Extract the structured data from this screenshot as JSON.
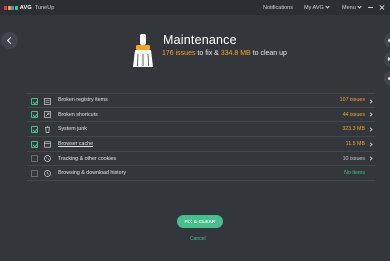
{
  "app": {
    "brand": "AVG",
    "product": "TuneUp"
  },
  "nav": {
    "notifications": "Notifications",
    "my_avg": "My AVG",
    "menu": "Menu"
  },
  "hero": {
    "title": "Maintenance",
    "issues": "176 issues",
    "middle": " to fix & ",
    "size": "334.8 MB",
    "suffix": " to clean up"
  },
  "items": [
    {
      "label": "Broken registry items",
      "value": "107 issues",
      "checked": true,
      "value_color": "orange",
      "has_chevron": true,
      "underlined": false,
      "icon": "registry-icon"
    },
    {
      "label": "Broken shortcuts",
      "value": "44 issues",
      "checked": true,
      "value_color": "orange",
      "has_chevron": true,
      "underlined": false,
      "icon": "shortcut-icon"
    },
    {
      "label": "System junk",
      "value": "323.3 MB",
      "checked": true,
      "value_color": "orange",
      "has_chevron": true,
      "underlined": false,
      "icon": "trash-icon"
    },
    {
      "label": "Browser cache",
      "value": "11.5 MB",
      "checked": true,
      "value_color": "orange",
      "has_chevron": true,
      "underlined": true,
      "icon": "browser-icon"
    },
    {
      "label": "Tracking & other cookies",
      "value": "10 issues",
      "checked": false,
      "value_color": "grey",
      "has_chevron": true,
      "underlined": false,
      "icon": "cookie-icon"
    },
    {
      "label": "Browsing & download history",
      "value": "No items",
      "checked": false,
      "value_color": "green",
      "has_chevron": false,
      "underlined": false,
      "icon": "history-icon"
    }
  ],
  "actions": {
    "fix_label": "FIX & CLEAN",
    "cancel_label": "Cancel"
  },
  "colors": {
    "background": "#33373c",
    "accent_green": "#45c08d",
    "accent_orange": "#f5a623"
  }
}
